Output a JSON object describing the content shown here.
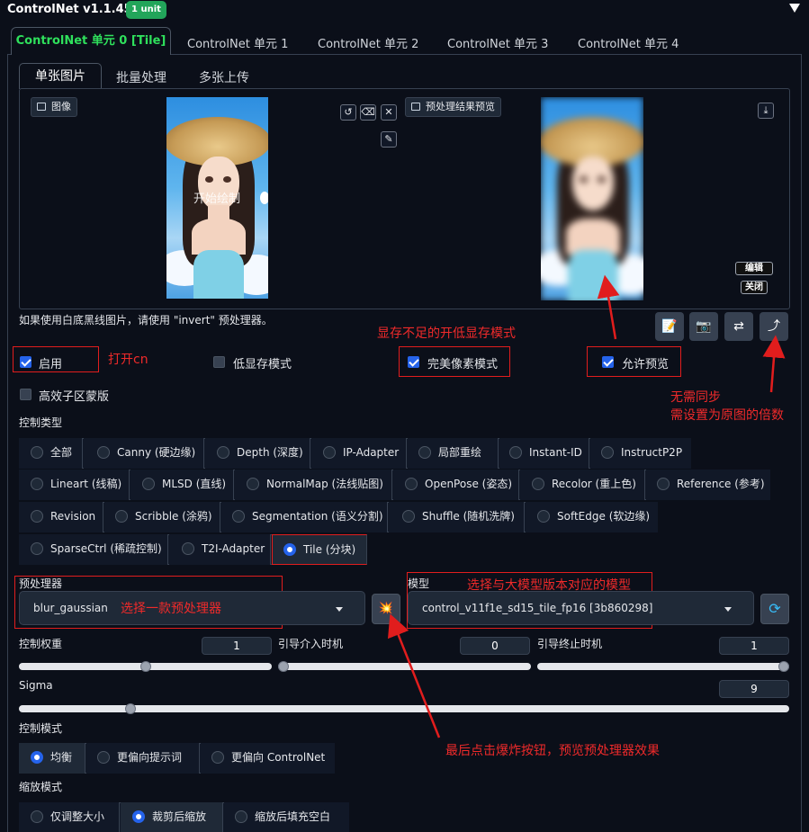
{
  "header": {
    "title": "ControlNet v1.1.455",
    "badge": "1 unit"
  },
  "unit_tabs": [
    {
      "label": "ControlNet 单元 0 [Tile]",
      "active": true
    },
    {
      "label": "ControlNet 单元 1"
    },
    {
      "label": "ControlNet 单元 2"
    },
    {
      "label": "ControlNet 单元 3"
    },
    {
      "label": "ControlNet 单元 4"
    }
  ],
  "input_tabs": [
    {
      "label": "单张图片",
      "active": true
    },
    {
      "label": "批量处理"
    },
    {
      "label": "多张上传"
    }
  ],
  "image_panel": {
    "image_label": "图像",
    "preview_label": "预处理结果预览",
    "overlay_text": "开始绘制",
    "edit_label": "编辑",
    "close_label": "关闭"
  },
  "hint": "如果使用白底黑线图片，请使用 \"invert\" 预处理器。",
  "checkboxes": {
    "enable": {
      "label": "启用",
      "checked": true
    },
    "low_vram": {
      "label": "低显存模式",
      "checked": false
    },
    "pixel_perfect": {
      "label": "完美像素模式",
      "checked": true
    },
    "allow_preview": {
      "label": "允许预览",
      "checked": true
    },
    "effective_region": {
      "label": "高效子区蒙版",
      "checked": false
    }
  },
  "annotations": {
    "enable_cn": "打开cn",
    "low_vram_note": "显存不足的开低显存模式",
    "no_sync": "无需同步",
    "multiple": "需设置为原图的倍数",
    "choose_preprocessor": "选择一款预处理器",
    "choose_model": "选择与大模型版本对应的模型",
    "explode_note": "最后点击爆炸按钮，预览预处理器效果"
  },
  "control_type": {
    "label": "控制类型",
    "options": [
      "全部",
      "Canny (硬边缘)",
      "Depth (深度)",
      "IP-Adapter",
      "局部重绘",
      "Instant-ID",
      "InstructP2P",
      "Lineart (线稿)",
      "MLSD (直线)",
      "NormalMap (法线贴图)",
      "OpenPose (姿态)",
      "Recolor (重上色)",
      "Reference (参考)",
      "Revision",
      "Scribble (涂鸦)",
      "Segmentation (语义分割)",
      "Shuffle (随机洗牌)",
      "SoftEdge (软边缘)",
      "SparseCtrl (稀疏控制)",
      "T2I-Adapter",
      "Tile (分块)"
    ],
    "selected": "Tile (分块)"
  },
  "preprocessor": {
    "label": "预处理器",
    "value": "blur_gaussian"
  },
  "model": {
    "label": "模型",
    "value": "control_v11f1e_sd15_tile_fp16 [3b860298]"
  },
  "sliders": {
    "weight": {
      "label": "控制权重",
      "value": "1",
      "fraction": 0.5
    },
    "start": {
      "label": "引导介入时机",
      "value": "0",
      "fraction": 0.0
    },
    "end": {
      "label": "引导终止时机",
      "value": "1",
      "fraction": 1.0
    },
    "sigma": {
      "label": "Sigma",
      "value": "9",
      "fraction": 0.14
    }
  },
  "control_mode": {
    "label": "控制模式",
    "options": [
      "均衡",
      "更偏向提示词",
      "更偏向 ControlNet"
    ],
    "selected": "均衡"
  },
  "resize_mode": {
    "label": "缩放模式",
    "options": [
      "仅调整大小",
      "裁剪后缩放",
      "缩放后填充空白"
    ],
    "selected": "裁剪后缩放"
  },
  "icons": {
    "undo": "↺",
    "eraser": "⌫",
    "close": "✕",
    "brush": "✎",
    "download": "⤓",
    "explode": "💥",
    "refresh": "⟳",
    "camera": "📷",
    "swap": "⇄",
    "send": "⤴",
    "doc": "📝"
  },
  "colors": {
    "accent": "#2563eb",
    "active_tab": "#2fe05c",
    "annotation": "#ef2a2a",
    "badge": "#22a55a"
  }
}
